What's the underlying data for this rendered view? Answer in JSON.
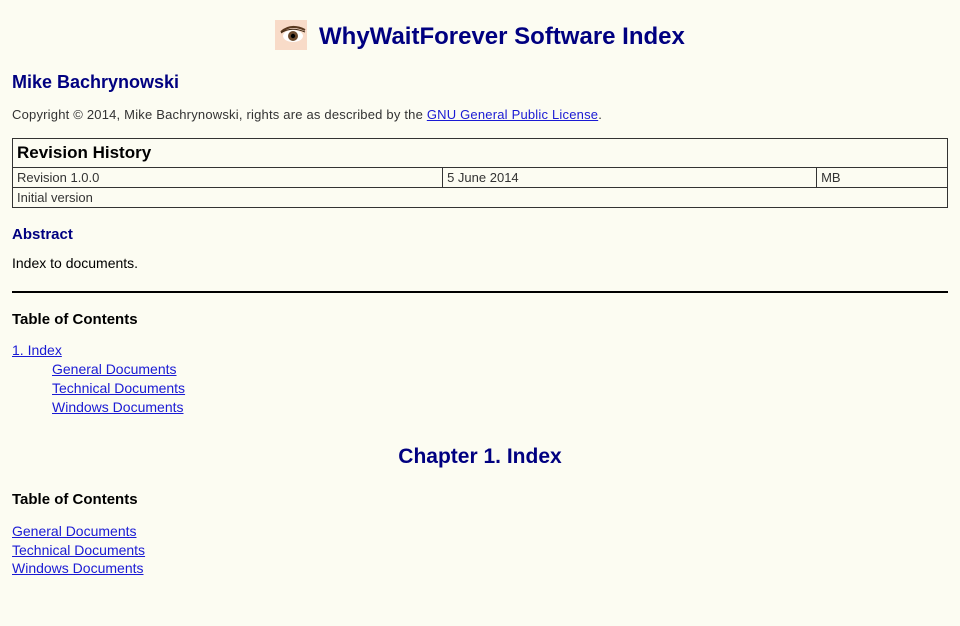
{
  "title": "WhyWaitForever Software Index",
  "author": "Mike Bachrynowski",
  "copyright_prefix": "Copyright © 2014, Mike Bachrynowski, rights are as described by the ",
  "license_link_text": "GNU General Public License",
  "copyright_suffix": ".",
  "rev_history_heading": "Revision History",
  "revision": {
    "number": "Revision 1.0.0",
    "date": "5 June 2014",
    "initials": "MB",
    "desc": "Initial version"
  },
  "abstract_heading": "Abstract",
  "abstract_body": "Index to documents.",
  "toc_heading": "Table of Contents",
  "toc_index_link": "1. Index",
  "toc_items": {
    "general": "General Documents",
    "technical": "Technical Documents",
    "windows": "Windows Documents"
  },
  "chapter_heading": "Chapter 1. Index"
}
